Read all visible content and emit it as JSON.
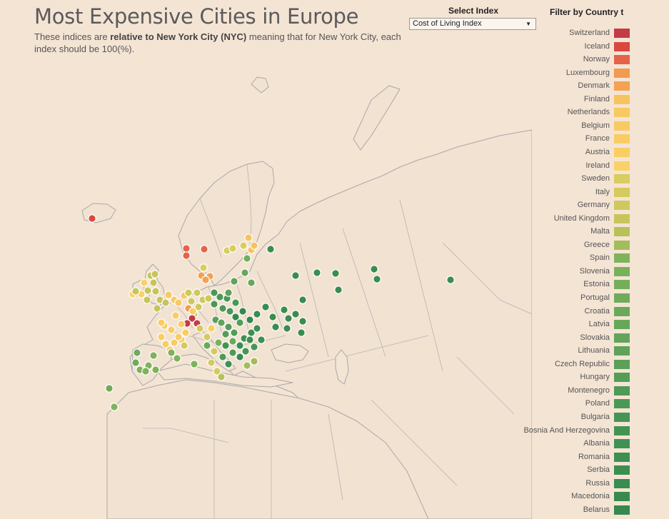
{
  "header": {
    "title": "Most Expensive Cities in Europe",
    "subtitle_part1": "These indices are ",
    "subtitle_bold1": "relative to New York City",
    "subtitle_part2": " ",
    "subtitle_bold2": "(NYC)",
    "subtitle_part3": " meaning that for New York City, each index should be 100(%)."
  },
  "controls": {
    "select_index_label": "Select Index",
    "select_index_value": "Cost of Living Index",
    "filter_title": "Filter by Country t"
  },
  "legend": [
    {
      "name": "Switzerland",
      "color": "#c33b45"
    },
    {
      "name": "Iceland",
      "color": "#d9473f"
    },
    {
      "name": "Norway",
      "color": "#e4634a"
    },
    {
      "name": "Luxembourg",
      "color": "#f19a52"
    },
    {
      "name": "Denmark",
      "color": "#f3a253"
    },
    {
      "name": "Finland",
      "color": "#f7c35f"
    },
    {
      "name": "Netherlands",
      "color": "#f8c862"
    },
    {
      "name": "Belgium",
      "color": "#f8ca62"
    },
    {
      "name": "France",
      "color": "#f9cd63"
    },
    {
      "name": "Austria",
      "color": "#f9cf64"
    },
    {
      "name": "Ireland",
      "color": "#f9d166"
    },
    {
      "name": "Sweden",
      "color": "#d9cc60"
    },
    {
      "name": "Italy",
      "color": "#d6ca5f"
    },
    {
      "name": "Germany",
      "color": "#cfc85e"
    },
    {
      "name": "United Kingdom",
      "color": "#c8c45c"
    },
    {
      "name": "Malta",
      "color": "#b8c05a"
    },
    {
      "name": "Greece",
      "color": "#a4bc59"
    },
    {
      "name": "Spain",
      "color": "#7fb35a"
    },
    {
      "name": "Slovenia",
      "color": "#79b15b"
    },
    {
      "name": "Estonia",
      "color": "#75ae5b"
    },
    {
      "name": "Portugal",
      "color": "#70ab5a"
    },
    {
      "name": "Croatia",
      "color": "#6ba95a"
    },
    {
      "name": "Latvia",
      "color": "#68a75a"
    },
    {
      "name": "Slovakia",
      "color": "#64a45a"
    },
    {
      "name": "Lithuania",
      "color": "#60a259"
    },
    {
      "name": "Czech Republic",
      "color": "#5aa058"
    },
    {
      "name": "Hungary",
      "color": "#549d57"
    },
    {
      "name": "Montenegro",
      "color": "#4e9a56"
    },
    {
      "name": "Poland",
      "color": "#4a9855"
    },
    {
      "name": "Bulgaria",
      "color": "#469554"
    },
    {
      "name": "Bosnia And Herzegovina",
      "color": "#439453"
    },
    {
      "name": "Albania",
      "color": "#409252"
    },
    {
      "name": "Romania",
      "color": "#3e9051"
    },
    {
      "name": "Serbia",
      "color": "#3c8e50"
    },
    {
      "name": "Russia",
      "color": "#3a8c4f"
    },
    {
      "name": "Macedonia",
      "color": "#388a4e"
    },
    {
      "name": "Belarus",
      "color": "#36884d"
    }
  ],
  "map": {
    "land_color": "#f2e2d2",
    "border_color": "#a8a8a8",
    "marker_outline": "#ffffff"
  }
}
